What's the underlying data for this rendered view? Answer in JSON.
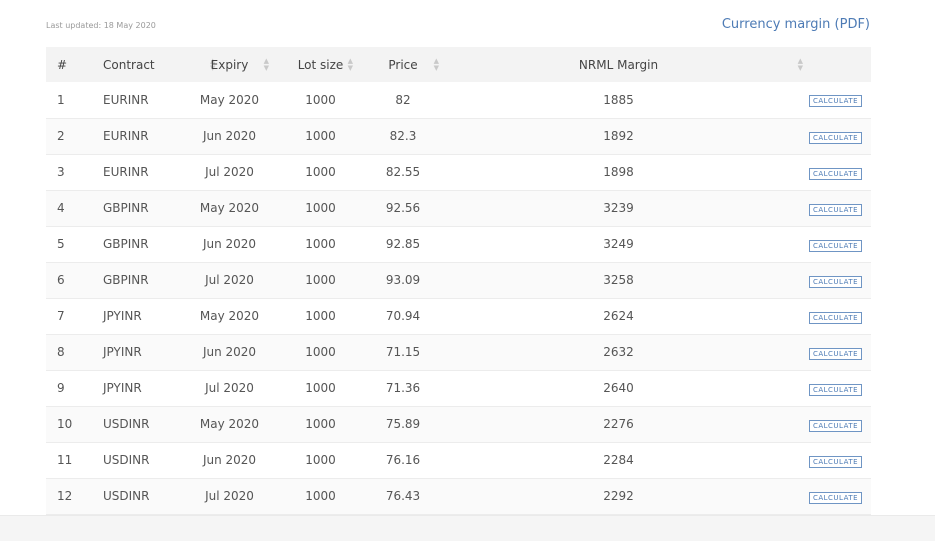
{
  "page": {
    "last_updated": "Last updated: 18 May 2020",
    "pdf_link": "Currency margin (PDF)"
  },
  "table": {
    "columns": [
      "#",
      "Contract",
      "Expiry",
      "Lot size",
      "Price",
      "NRML Margin",
      ""
    ],
    "rows": [
      {
        "n": "1",
        "contract": "EURINR",
        "expiry": "May 2020",
        "lot": "1000",
        "price": "82",
        "margin": "1885",
        "action": "CALCULATE"
      },
      {
        "n": "2",
        "contract": "EURINR",
        "expiry": "Jun 2020",
        "lot": "1000",
        "price": "82.3",
        "margin": "1892",
        "action": "CALCULATE"
      },
      {
        "n": "3",
        "contract": "EURINR",
        "expiry": "Jul 2020",
        "lot": "1000",
        "price": "82.55",
        "margin": "1898",
        "action": "CALCULATE"
      },
      {
        "n": "4",
        "contract": "GBPINR",
        "expiry": "May 2020",
        "lot": "1000",
        "price": "92.56",
        "margin": "3239",
        "action": "CALCULATE"
      },
      {
        "n": "5",
        "contract": "GBPINR",
        "expiry": "Jun 2020",
        "lot": "1000",
        "price": "92.85",
        "margin": "3249",
        "action": "CALCULATE"
      },
      {
        "n": "6",
        "contract": "GBPINR",
        "expiry": "Jul 2020",
        "lot": "1000",
        "price": "93.09",
        "margin": "3258",
        "action": "CALCULATE"
      },
      {
        "n": "7",
        "contract": "JPYINR",
        "expiry": "May 2020",
        "lot": "1000",
        "price": "70.94",
        "margin": "2624",
        "action": "CALCULATE"
      },
      {
        "n": "8",
        "contract": "JPYINR",
        "expiry": "Jun 2020",
        "lot": "1000",
        "price": "71.15",
        "margin": "2632",
        "action": "CALCULATE"
      },
      {
        "n": "9",
        "contract": "JPYINR",
        "expiry": "Jul 2020",
        "lot": "1000",
        "price": "71.36",
        "margin": "2640",
        "action": "CALCULATE"
      },
      {
        "n": "10",
        "contract": "USDINR",
        "expiry": "May 2020",
        "lot": "1000",
        "price": "75.89",
        "margin": "2276",
        "action": "CALCULATE"
      },
      {
        "n": "11",
        "contract": "USDINR",
        "expiry": "Jun 2020",
        "lot": "1000",
        "price": "76.16",
        "margin": "2284",
        "action": "CALCULATE"
      },
      {
        "n": "12",
        "contract": "USDINR",
        "expiry": "Jul 2020",
        "lot": "1000",
        "price": "76.43",
        "margin": "2292",
        "action": "CALCULATE"
      }
    ]
  },
  "icons": {
    "sort": "sort-icon"
  },
  "colors": {
    "accent": "#4d7bb5",
    "header_bg": "#f3f3f3"
  }
}
